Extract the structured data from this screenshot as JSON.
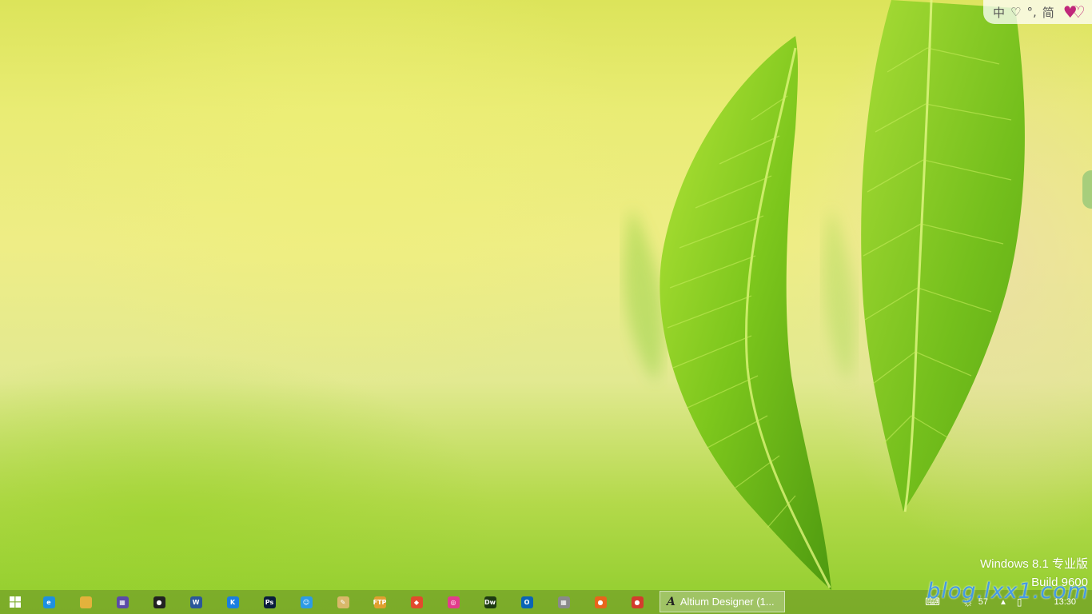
{
  "ime_toolbar": {
    "lang": "中",
    "heart": "♡",
    "punct": "°,",
    "mode": "简",
    "hearts": "♥♡"
  },
  "watermark": {
    "line1": "Windows 8.1 专业版",
    "line2": "Build 9600"
  },
  "taskbar": {
    "pinned": [
      {
        "name": "internet-explorer-icon",
        "glyph": "e",
        "color": "#1e90e0"
      },
      {
        "name": "file-explorer-icon",
        "glyph": "",
        "color": "#e3b23c"
      },
      {
        "name": "calculator-icon",
        "glyph": "▦",
        "color": "#5b4aa8"
      },
      {
        "name": "qq-icon",
        "glyph": "●",
        "color": "#222222"
      },
      {
        "name": "word-icon",
        "glyph": "W",
        "color": "#2b579a"
      },
      {
        "name": "kugou-icon",
        "glyph": "K",
        "color": "#1a7ee0"
      },
      {
        "name": "photoshop-icon",
        "glyph": "Ps",
        "color": "#0a1d3c"
      },
      {
        "name": "messenger-icon",
        "glyph": "☺",
        "color": "#2c9be6"
      },
      {
        "name": "notepad-icon",
        "glyph": "✎",
        "color": "#d9b86a"
      },
      {
        "name": "ftp-icon",
        "glyph": "FTP",
        "color": "#e0a030"
      },
      {
        "name": "git-icon",
        "glyph": "◆",
        "color": "#e24a2d"
      },
      {
        "name": "music-icon",
        "glyph": "◎",
        "color": "#e23c8c"
      },
      {
        "name": "dreamweaver-icon",
        "glyph": "Dw",
        "color": "#1e3a12"
      },
      {
        "name": "outlook-icon",
        "glyph": "O",
        "color": "#0a64b6"
      },
      {
        "name": "grid-app-icon",
        "glyph": "▦",
        "color": "#8a8a8a"
      },
      {
        "name": "firefox-icon",
        "glyph": "●",
        "color": "#e8651c"
      },
      {
        "name": "chrome-icon",
        "glyph": "●",
        "color": "#d33c2d"
      }
    ],
    "active_task": {
      "label": "Altium Designer (1..."
    },
    "tray": {
      "brightness": "57",
      "time": "13:30"
    }
  },
  "blog_watermark": "blog.lxx1.com"
}
